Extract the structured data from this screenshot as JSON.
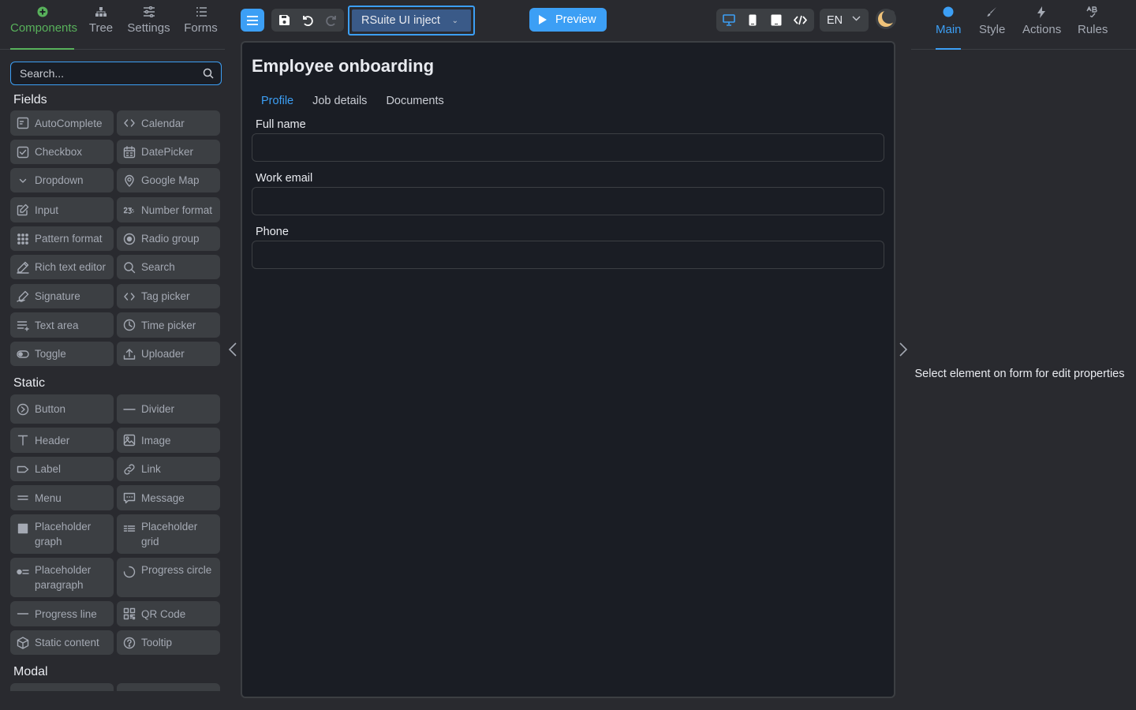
{
  "left_tabs": [
    {
      "label": "Components",
      "icon": "plus-circle-icon",
      "active": true
    },
    {
      "label": "Tree",
      "icon": "tree-icon"
    },
    {
      "label": "Settings",
      "icon": "sliders-icon"
    },
    {
      "label": "Forms",
      "icon": "list-icon"
    }
  ],
  "search": {
    "placeholder": "Search..."
  },
  "sections": {
    "fields": "Fields",
    "static": "Static",
    "modal": "Modal"
  },
  "fields": [
    {
      "label": "AutoComplete",
      "icon": "autocomplete-icon"
    },
    {
      "label": "Calendar",
      "icon": "code-brackets-icon"
    },
    {
      "label": "Checkbox",
      "icon": "checkbox-icon"
    },
    {
      "label": "DatePicker",
      "icon": "calendar-icon"
    },
    {
      "label": "Dropdown",
      "icon": "chevron-down-icon"
    },
    {
      "label": "Google Map",
      "icon": "map-pin-icon"
    },
    {
      "label": "Input",
      "icon": "edit-icon"
    },
    {
      "label": "Number format",
      "icon": "number-icon"
    },
    {
      "label": "Pattern format",
      "icon": "grid-dots-icon"
    },
    {
      "label": "Radio group",
      "icon": "radio-icon"
    },
    {
      "label": "Rich text editor",
      "icon": "pen-icon"
    },
    {
      "label": "Search",
      "icon": "search-icon"
    },
    {
      "label": "Signature",
      "icon": "signature-icon"
    },
    {
      "label": "Tag picker",
      "icon": "code-brackets-icon"
    },
    {
      "label": "Text area",
      "icon": "text-area-icon"
    },
    {
      "label": "Time picker",
      "icon": "clock-icon"
    },
    {
      "label": "Toggle",
      "icon": "toggle-icon"
    },
    {
      "label": "Uploader",
      "icon": "upload-icon"
    }
  ],
  "statics": [
    {
      "label": "Button",
      "icon": "button-icon"
    },
    {
      "label": "Divider",
      "icon": "divider-icon"
    },
    {
      "label": "Header",
      "icon": "header-icon"
    },
    {
      "label": "Image",
      "icon": "image-icon"
    },
    {
      "label": "Label",
      "icon": "label-icon"
    },
    {
      "label": "Link",
      "icon": "link-icon"
    },
    {
      "label": "Menu",
      "icon": "menu-icon"
    },
    {
      "label": "Message",
      "icon": "message-icon"
    },
    {
      "label": "Placeholder graph",
      "icon": "placeholder-graph-icon"
    },
    {
      "label": "Placeholder grid",
      "icon": "placeholder-grid-icon"
    },
    {
      "label": "Placeholder paragraph",
      "icon": "placeholder-paragraph-icon"
    },
    {
      "label": "Progress circle",
      "icon": "progress-circle-icon"
    },
    {
      "label": "Progress line",
      "icon": "progress-line-icon"
    },
    {
      "label": "QR Code",
      "icon": "qr-code-icon"
    },
    {
      "label": "Static content",
      "icon": "cube-icon"
    },
    {
      "label": "Tooltip",
      "icon": "question-circle-icon"
    }
  ],
  "toolbar": {
    "theme_select": "RSuite UI inject",
    "preview_label": "Preview",
    "language": "EN"
  },
  "form": {
    "title": "Employee onboarding",
    "tabs": [
      {
        "label": "Profile",
        "active": true
      },
      {
        "label": "Job details"
      },
      {
        "label": "Documents"
      }
    ],
    "fields": [
      {
        "label": "Full name",
        "value": ""
      },
      {
        "label": "Work email",
        "value": ""
      },
      {
        "label": "Phone",
        "value": ""
      }
    ]
  },
  "right_tabs": [
    {
      "label": "Main",
      "icon": "dot-icon",
      "active": true
    },
    {
      "label": "Style",
      "icon": "brush-icon"
    },
    {
      "label": "Actions",
      "icon": "bolt-icon"
    },
    {
      "label": "Rules",
      "icon": "rules-icon"
    }
  ],
  "properties_hint": "Select element on form for edit properties",
  "colors": {
    "accent": "#3c9ff5",
    "active_components": "#58b15b",
    "panel_bg": "#292a2f",
    "canvas_bg": "#1a1d24",
    "item_bg": "#3c3f43"
  }
}
